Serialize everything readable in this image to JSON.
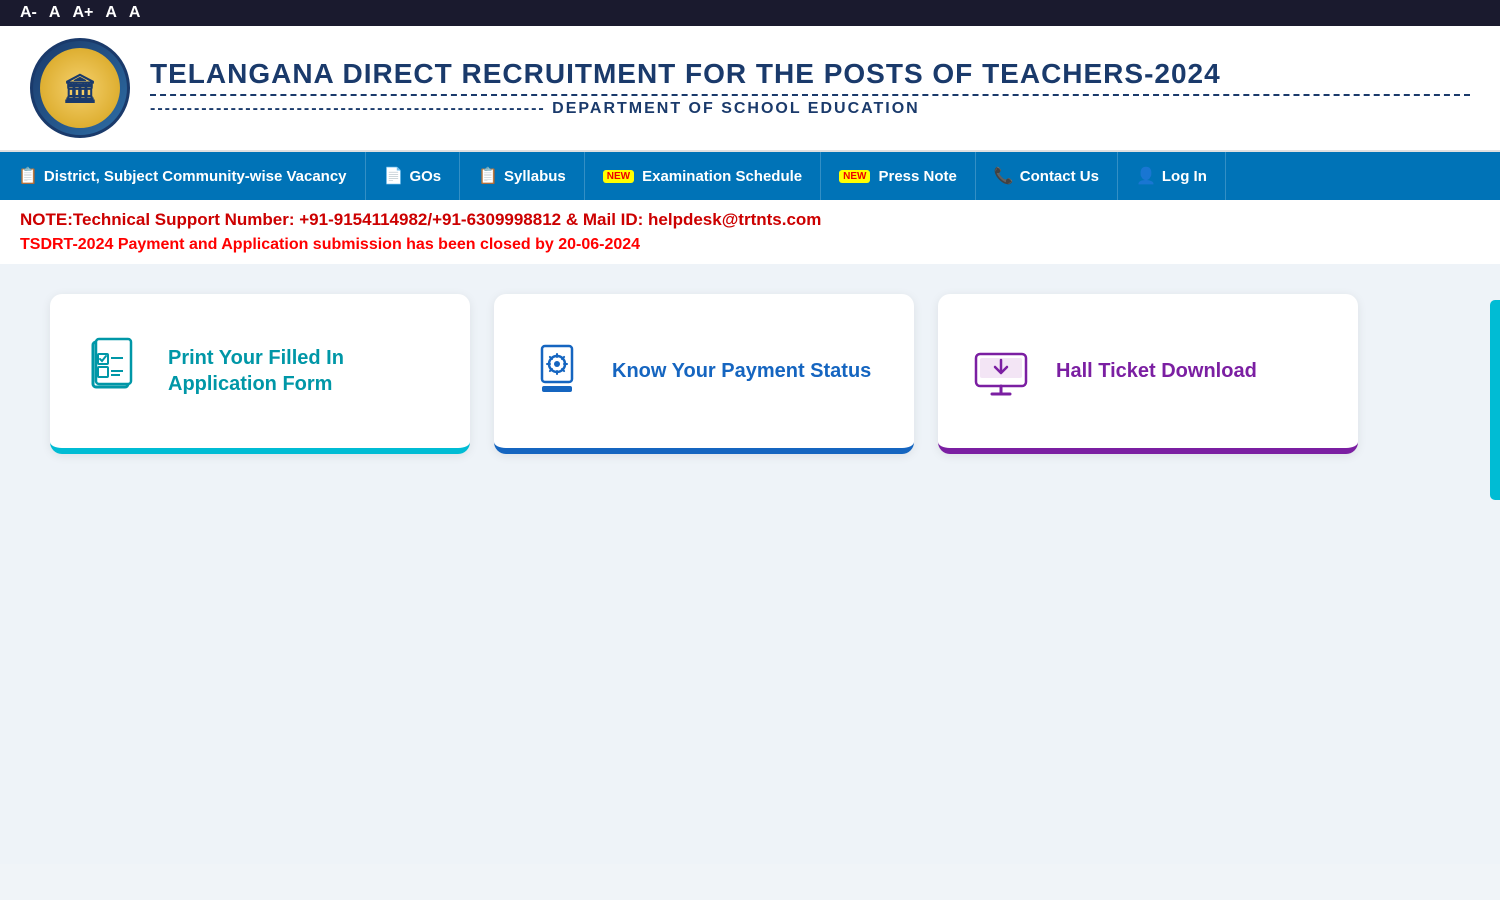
{
  "accessibility": {
    "decrease_label": "A-",
    "normal_label": "A",
    "increase_label": "A+",
    "contrast1_label": "A",
    "contrast2_label": "A"
  },
  "header": {
    "title": "TELANGANA DIRECT RECRUITMENT FOR THE POSTS OF TEACHERS-2024",
    "subtitle": "DEPARTMENT OF SCHOOL EDUCATION",
    "logo_alt": "Government of Telangana Seal"
  },
  "nav": {
    "items": [
      {
        "label": "District, Subject Community-wise Vacancy",
        "icon": "📋",
        "new": false
      },
      {
        "label": "GOs",
        "icon": "📄",
        "new": false
      },
      {
        "label": "Syllabus",
        "icon": "📋",
        "new": false
      },
      {
        "label": "Examination Schedule",
        "icon": "",
        "new": true
      },
      {
        "label": "Press Note",
        "icon": "",
        "new": true
      },
      {
        "label": "Contact Us",
        "icon": "📞",
        "new": false
      },
      {
        "label": "Log In",
        "icon": "👤",
        "new": false
      }
    ]
  },
  "notices": {
    "technical_support": "NOTE:Technical Support Number: +91-9154114982/+91-6309998812 & Mail ID: helpdesk@trtnts.com",
    "closed_notice": "TSDRT-2024 Payment and Application submission has been closed by 20-06-2024"
  },
  "cards": [
    {
      "id": "print-application",
      "label": "Print Your Filled In Application Form",
      "color": "#0097a7",
      "border_color": "#00bcd4"
    },
    {
      "id": "payment-status",
      "label": "Know Your Payment Status",
      "color": "#1565c0",
      "border_color": "#1565c0"
    },
    {
      "id": "hall-ticket",
      "label": "Hall Ticket Download",
      "color": "#7b1fa2",
      "border_color": "#7b1fa2"
    }
  ]
}
